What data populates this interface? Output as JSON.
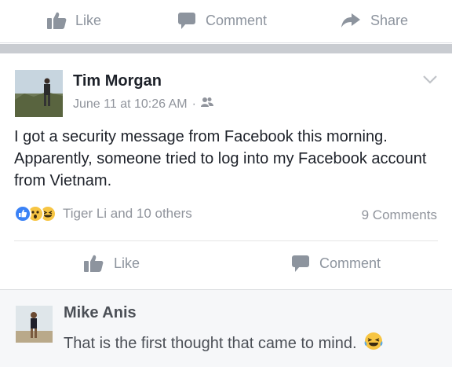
{
  "top_actions": {
    "like": "Like",
    "comment": "Comment",
    "share": "Share"
  },
  "post": {
    "author": "Tim Morgan",
    "timestamp": "June 11 at 10:26 AM",
    "separator": "·",
    "text": "I got a security message from Facebook this morning. Apparently, someone tried to log into my Facebook account from Vietnam.",
    "reactions_text": "Tiger Li and 10 others",
    "comments_count": "9 Comments",
    "actions": {
      "like": "Like",
      "comment": "Comment"
    }
  },
  "comment": {
    "author": "Mike Anis",
    "text": "That is the first thought that came to mind."
  },
  "colors": {
    "muted": "#8d949e",
    "like_blue": "#3b82f6",
    "reaction_yellow": "#f7c543",
    "text_dark": "#1d2129"
  }
}
